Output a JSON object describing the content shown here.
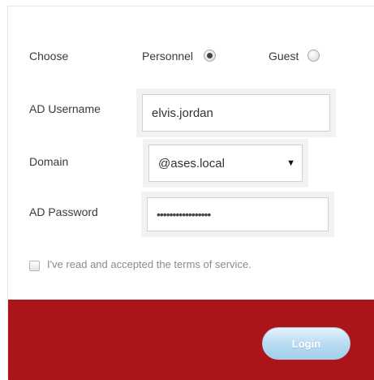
{
  "choose": {
    "label": "Choose",
    "options": [
      {
        "label": "Personnel",
        "selected": true
      },
      {
        "label": "Guest",
        "selected": false
      }
    ]
  },
  "username": {
    "label": "AD Username",
    "value": "elvis.jordan"
  },
  "domain": {
    "label": "Domain",
    "selected": "@ases.local"
  },
  "password": {
    "label": "AD Password",
    "masked_value": "•••••••••••••••••"
  },
  "terms": {
    "label": "I've read and accepted the terms of service.",
    "checked": false
  },
  "footer": {
    "login_label": "Login",
    "background_color": "#ab1418"
  },
  "icons": {
    "domain_caret": "caret-down-icon"
  }
}
